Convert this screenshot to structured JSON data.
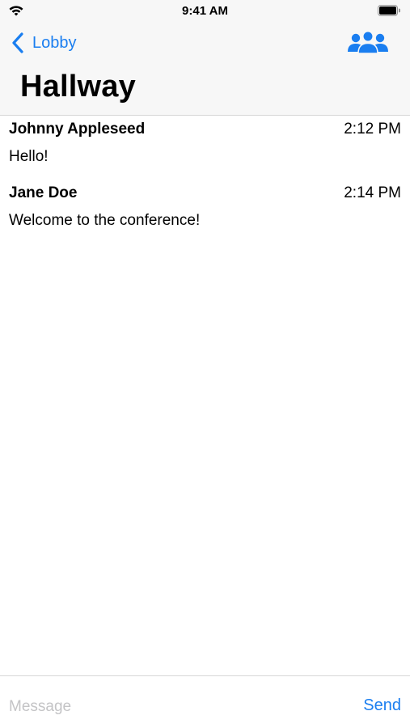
{
  "status_bar": {
    "time": "9:41 AM",
    "wifi_icon": "wifi-icon",
    "battery_icon": "battery-icon"
  },
  "nav": {
    "back_label": "Lobby",
    "back_icon": "chevron-left-icon",
    "title": "Hallway",
    "people_icon": "people-icon",
    "accent_color": "#1a7ef0"
  },
  "messages": [
    {
      "sender": "Johnny Appleseed",
      "time": "2:12 PM",
      "text": "Hello!"
    },
    {
      "sender": "Jane Doe",
      "time": "2:14 PM",
      "text": "Welcome to the conference!"
    }
  ],
  "composer": {
    "value": "",
    "placeholder": "Message",
    "send_label": "Send"
  }
}
